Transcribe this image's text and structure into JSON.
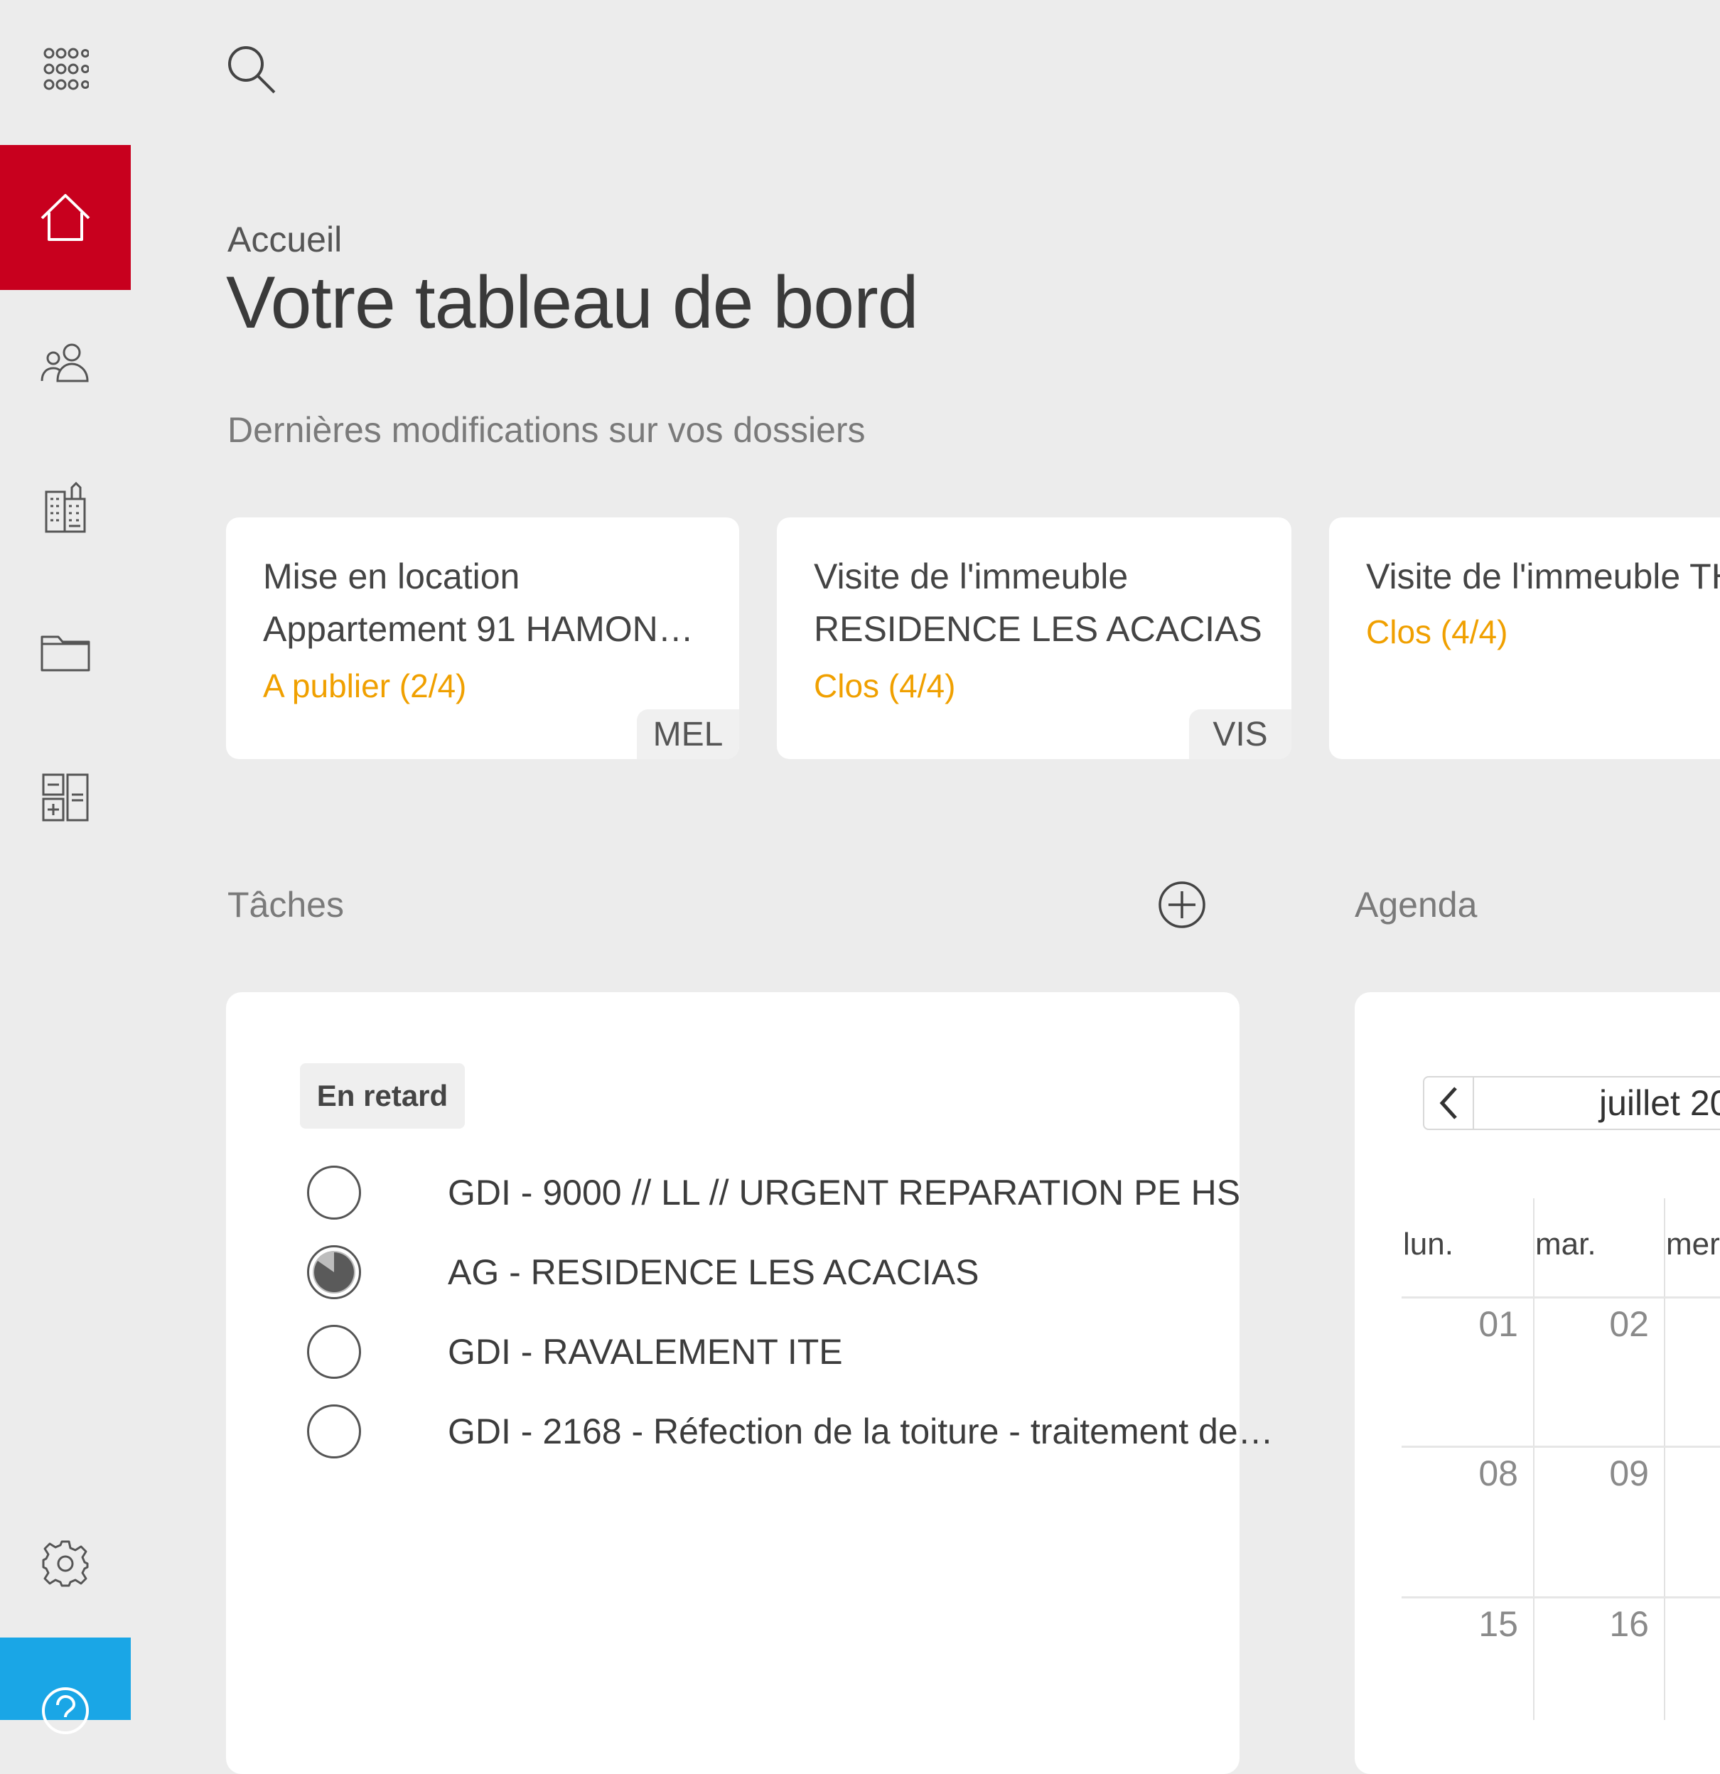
{
  "sidebar": {
    "items": [
      {
        "icon": "apps-grid-icon"
      },
      {
        "icon": "home-icon",
        "active": true
      },
      {
        "icon": "people-icon"
      },
      {
        "icon": "building-icon"
      },
      {
        "icon": "folder-icon"
      },
      {
        "icon": "calculator-icon"
      },
      {
        "icon": "gear-icon"
      },
      {
        "icon": "help-icon"
      }
    ],
    "active_color": "#c8001e",
    "help_color": "#1aa6e6"
  },
  "header": {
    "search_icon": "search-icon",
    "breadcrumb": "Accueil",
    "title": "Votre tableau de bord"
  },
  "recent": {
    "label": "Dernières modifications sur vos dossiers",
    "cards": [
      {
        "line1": "Mise en location",
        "line2": "Appartement 91 HAMON…",
        "status": "A publier (2/4)",
        "tag": "MEL"
      },
      {
        "line1": "Visite de l'immeuble",
        "line2": "RESIDENCE LES ACACIAS",
        "status": "Clos (4/4)",
        "tag": "VIS"
      },
      {
        "line1": "Visite de l'immeuble TH",
        "status": "Clos (4/4)"
      }
    ],
    "status_color": "#f0a000"
  },
  "tasks": {
    "label": "Tâches",
    "filter": "En retard",
    "items": [
      {
        "text": "GDI - 9000 // LL // URGENT REPARATION PE HS",
        "state": "empty"
      },
      {
        "text": "AG - RESIDENCE LES ACACIAS",
        "state": "partial"
      },
      {
        "text": "GDI - RAVALEMENT ITE",
        "state": "empty"
      },
      {
        "text": "GDI - 2168 - Réfection de la toiture - traitement de…",
        "state": "empty"
      }
    ]
  },
  "agenda": {
    "label": "Agenda",
    "month": "juillet 20",
    "weekdays": [
      "lun.",
      "mar.",
      "mer."
    ],
    "weeks": [
      [
        "01",
        "02"
      ],
      [
        "08",
        "09"
      ],
      [
        "15",
        "16"
      ]
    ]
  }
}
